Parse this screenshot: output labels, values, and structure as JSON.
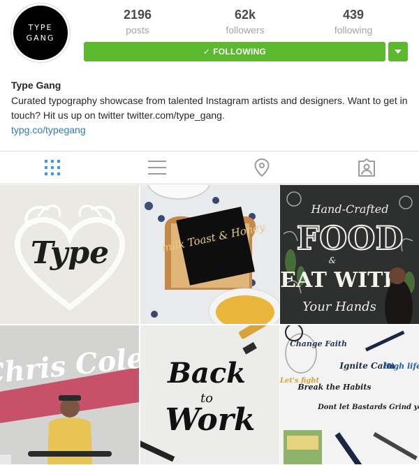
{
  "profile": {
    "avatar_line1": "TYPE",
    "avatar_line2": "GANG",
    "name": "Type Gang",
    "bio": "Curated typography showcase from talented Instagram artists and designers. Want to get in touch? Hit us up on twitter twitter.com/type_gang.",
    "website": "typg.co/typegang"
  },
  "stats": {
    "posts_count": "2196",
    "posts_label": "posts",
    "followers_count": "62k",
    "followers_label": "followers",
    "following_count": "439",
    "following_label": "following"
  },
  "actions": {
    "following_label": "FOLLOWING",
    "check_glyph": "✓"
  },
  "tabs": [
    {
      "name": "grid-view",
      "icon": "grid-icon",
      "active": true
    },
    {
      "name": "list-view",
      "icon": "list-icon",
      "active": false
    },
    {
      "name": "location",
      "icon": "location-pin-icon",
      "active": false
    },
    {
      "name": "tagged",
      "icon": "tagged-person-icon",
      "active": false
    }
  ],
  "posts": [
    {
      "text": "Type"
    },
    {
      "text": "milk Toast & Honey"
    },
    {
      "line1": "Hand-Crafted",
      "line2": "FOOD",
      "line3": "EAT WITH",
      "line4": "Your Hands"
    },
    {
      "text": "Chris Cole"
    },
    {
      "line1": "Back",
      "line2": "to",
      "line3": "Work"
    },
    {
      "a": "Change Faith",
      "b": "Ignite Calm",
      "c": "High life",
      "d": "Let's fight",
      "e": "Break the Habits",
      "f": "Dont let Bastards Grind you Down"
    }
  ],
  "colors": {
    "accent_green": "#5cb82e",
    "link_blue": "#2e7cb5",
    "active_tab_blue": "#3897f0",
    "inactive_icon": "#9b9b9b"
  }
}
